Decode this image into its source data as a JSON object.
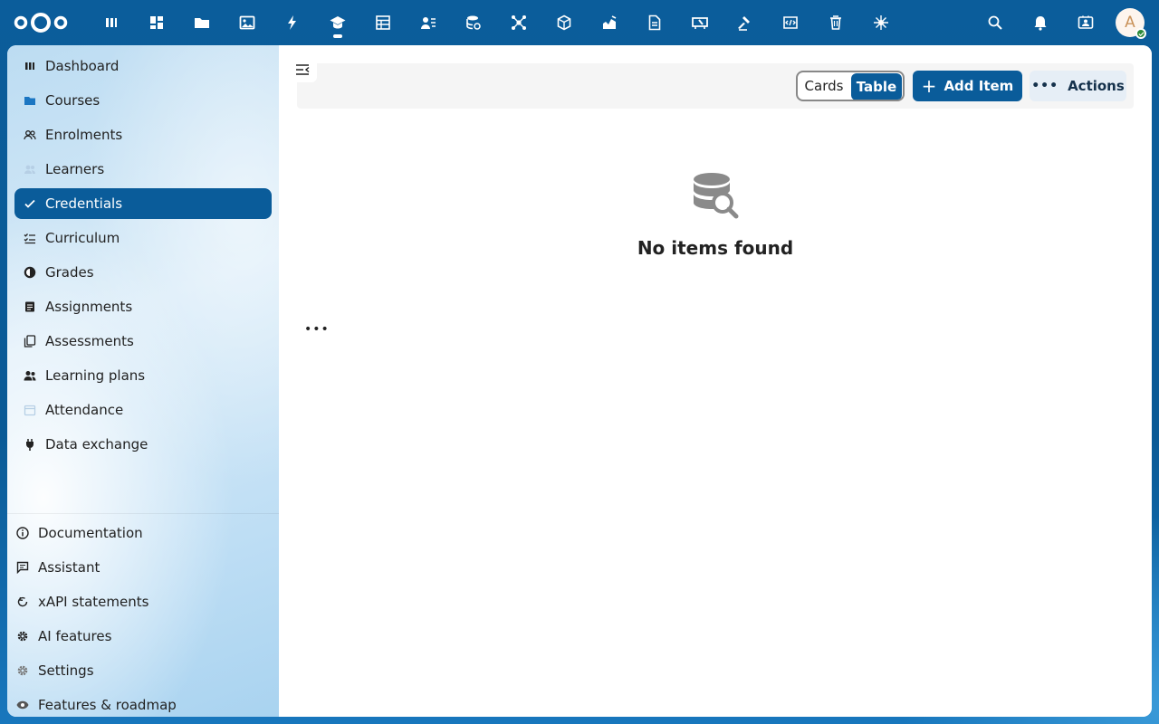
{
  "topbar": {
    "apps": [
      "dashboard-icon",
      "apps-grid-icon",
      "folder-icon",
      "image-icon",
      "activity-icon",
      "education-icon",
      "tables-icon",
      "contacts-icon",
      "database-icon",
      "network-icon",
      "cube-icon",
      "chart-icon",
      "document-icon",
      "whiteboard-icon",
      "hammer-icon",
      "code-icon",
      "trash-icon",
      "integration-icon"
    ],
    "active_app_index": 5,
    "avatar_letter": "A"
  },
  "sidebar": {
    "items": [
      {
        "label": "Dashboard",
        "icon": "dashboard-icon"
      },
      {
        "label": "Courses",
        "icon": "folder-icon"
      },
      {
        "label": "Enrolments",
        "icon": "people-icon"
      },
      {
        "label": "Learners",
        "icon": "learners-icon"
      },
      {
        "label": "Credentials",
        "icon": "check-icon"
      },
      {
        "label": "Curriculum",
        "icon": "checklist-icon"
      },
      {
        "label": "Grades",
        "icon": "contrast-icon"
      },
      {
        "label": "Assignments",
        "icon": "note-icon"
      },
      {
        "label": "Assessments",
        "icon": "copy-icon"
      },
      {
        "label": "Learning plans",
        "icon": "group-icon"
      },
      {
        "label": "Attendance",
        "icon": "calendar-icon"
      },
      {
        "label": "Data exchange",
        "icon": "plug-icon"
      }
    ],
    "active_index": 4,
    "footer": [
      {
        "label": "Documentation",
        "icon": "info-icon"
      },
      {
        "label": "Assistant",
        "icon": "chat-icon"
      },
      {
        "label": "xAPI statements",
        "icon": "refresh-icon"
      },
      {
        "label": "AI features",
        "icon": "gear-icon"
      },
      {
        "label": "Settings",
        "icon": "settings-icon"
      },
      {
        "label": "Features & roadmap",
        "icon": "eye-icon"
      }
    ]
  },
  "toolbar": {
    "view_cards": "Cards",
    "view_table": "Table",
    "add_item": "Add Item",
    "actions": "Actions"
  },
  "empty_state": {
    "title": "No items found"
  },
  "colors": {
    "primary": "#0a5c9a"
  }
}
